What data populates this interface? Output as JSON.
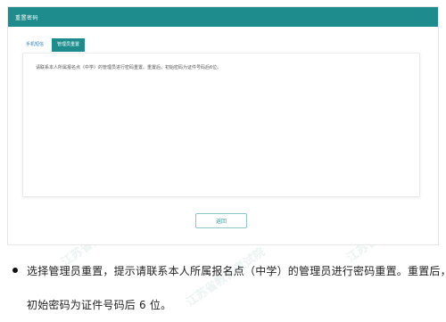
{
  "dialog": {
    "title": "重置密码"
  },
  "tabs": [
    {
      "label": "手机短信"
    },
    {
      "label": "管理员重置"
    }
  ],
  "notice": "请联系本人所属报名点（中学）的管理员进行密码重置。重置后，初始密码为证件号码后6位。",
  "back_button": "返回",
  "caption": {
    "line1": "选择管理员重置，提示请联系本人所属报名点（中学）的管理员进行密码重置。重置后，",
    "line2": "初始密码为证件号码后 6 位。"
  },
  "watermark": "江苏省教育考试院",
  "colors": {
    "header": "#1e8c8c",
    "tab_active": "#1e8c8c",
    "tab_inactive_text": "#2a7fbf"
  }
}
